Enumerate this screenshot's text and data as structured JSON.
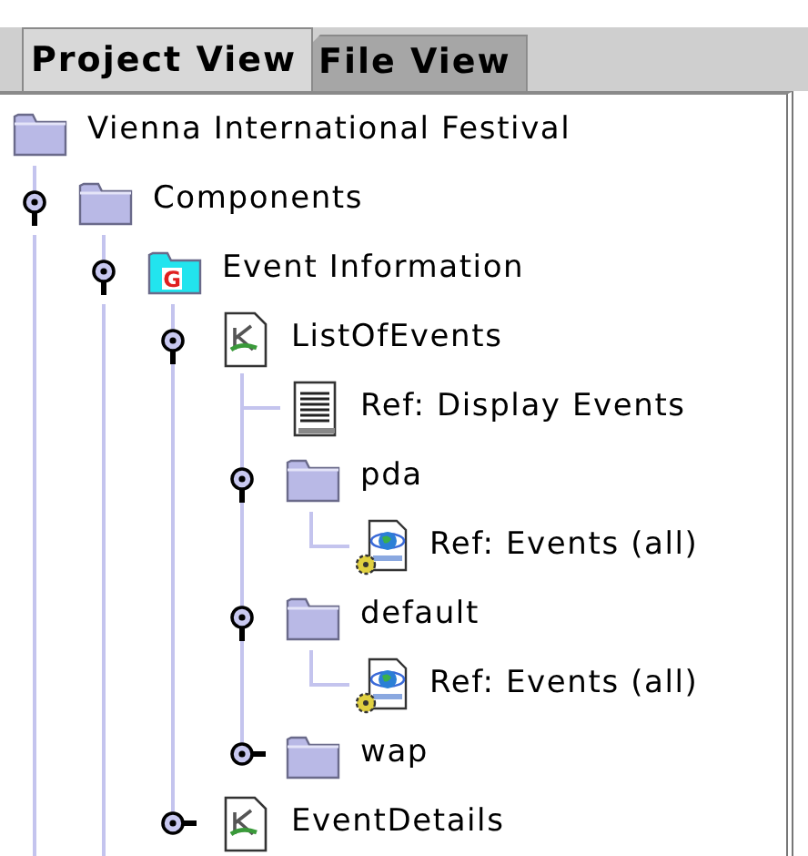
{
  "tabs": [
    {
      "label": "Project View",
      "selected": true
    },
    {
      "label": "File View",
      "selected": false
    }
  ],
  "tree": [
    {
      "label": "Vienna International Festival",
      "kind": "folder",
      "children": [
        {
          "label": "Components",
          "kind": "folder",
          "expanded": true,
          "children": [
            {
              "label": "Event Information",
              "kind": "group",
              "badge": "G",
              "expanded": true,
              "children": [
                {
                  "label": "ListOfEvents",
                  "kind": "page",
                  "expanded": true,
                  "children": [
                    {
                      "label": "Ref: Display Events",
                      "kind": "document"
                    },
                    {
                      "label": "pda",
                      "kind": "folder",
                      "expanded": true,
                      "children": [
                        {
                          "label": "Ref: Events (all)",
                          "kind": "webref"
                        }
                      ]
                    },
                    {
                      "label": "default",
                      "kind": "folder",
                      "expanded": true,
                      "children": [
                        {
                          "label": "Ref: Events (all)",
                          "kind": "webref"
                        }
                      ]
                    },
                    {
                      "label": "wap",
                      "kind": "folder",
                      "expanded": false
                    }
                  ]
                },
                {
                  "label": "EventDetails",
                  "kind": "page",
                  "expanded": false
                }
              ]
            }
          ]
        }
      ]
    }
  ]
}
